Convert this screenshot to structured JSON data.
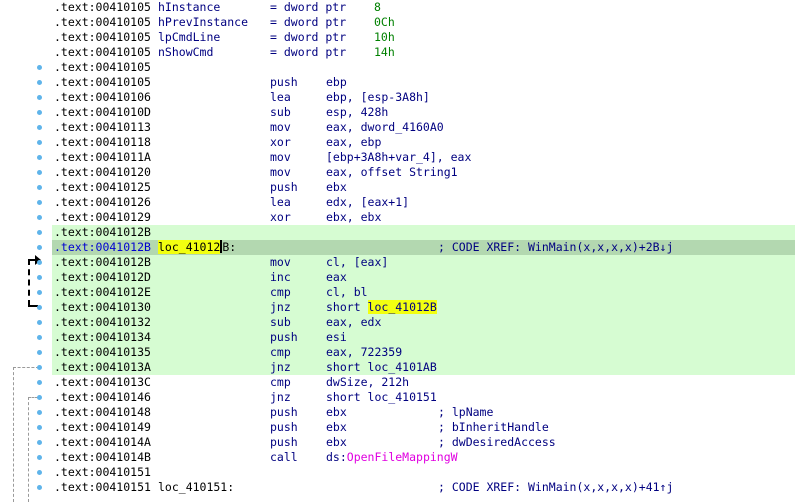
{
  "colors": {
    "code_bg": "#ffffff",
    "block_bg": "#d6fcd2",
    "current_line_bg": "#b3d8b0",
    "highlight": "#f2ff10",
    "breakpoint_dot": "#5fb4ea",
    "text_blue": "#000080",
    "constant_green": "#008000",
    "import_pink": "#e000e0"
  },
  "lines": [
    {
      "addr": ".text:00410105",
      "name": "hInstance",
      "eq": "= dword ptr",
      "val": "8"
    },
    {
      "addr": ".text:00410105",
      "name": "hPrevInstance",
      "eq": "= dword ptr",
      "val": "0Ch"
    },
    {
      "addr": ".text:00410105",
      "name": "lpCmdLine",
      "eq": "= dword ptr",
      "val": "10h"
    },
    {
      "addr": ".text:00410105",
      "name": "nShowCmd",
      "eq": "= dword ptr",
      "val": "14h"
    },
    {
      "addr": ".text:00410105"
    },
    {
      "addr": ".text:00410105",
      "mn": "push",
      "op": "ebp"
    },
    {
      "addr": ".text:00410106",
      "mn": "lea",
      "op": "ebp, [esp-3A8h]"
    },
    {
      "addr": ".text:0041010D",
      "mn": "sub",
      "op": "esp, 428h"
    },
    {
      "addr": ".text:00410113",
      "mn": "mov",
      "op": "eax, dword_4160A0"
    },
    {
      "addr": ".text:00410118",
      "mn": "xor",
      "op": "eax, ebp"
    },
    {
      "addr": ".text:0041011A",
      "mn": "mov",
      "op": "[ebp+3A8h+var_4], eax"
    },
    {
      "addr": ".text:00410120",
      "mn": "mov",
      "op": "eax, offset String1"
    },
    {
      "addr": ".text:00410125",
      "mn": "push",
      "op": "ebx"
    },
    {
      "addr": ".text:00410126",
      "mn": "lea",
      "op": "edx, [eax+1]"
    },
    {
      "addr": ".text:00410129",
      "mn": "xor",
      "op": "ebx, ebx"
    },
    {
      "addr": ".text:0041012B"
    },
    {
      "addr": ".text:0041012B",
      "label_a": "loc_41012",
      "label_b": "B:",
      "xref": "; CODE XREF: WinMain(x,x,x,x)+2B↓j"
    },
    {
      "addr": ".text:0041012B",
      "mn": "mov",
      "op": "cl, [eax]"
    },
    {
      "addr": ".text:0041012D",
      "mn": "inc",
      "op": "eax"
    },
    {
      "addr": ".text:0041012E",
      "mn": "cmp",
      "op": "cl, bl"
    },
    {
      "addr": ".text:00410130",
      "mn": "jnz",
      "op_pre": "short ",
      "op_hl": "loc_41012B"
    },
    {
      "addr": ".text:00410132",
      "mn": "sub",
      "op": "eax, edx"
    },
    {
      "addr": ".text:00410134",
      "mn": "push",
      "op": "esi"
    },
    {
      "addr": ".text:00410135",
      "mn": "cmp",
      "op": "eax, 722359"
    },
    {
      "addr": ".text:0041013A",
      "mn": "jnz",
      "op": "short loc_4101AB"
    },
    {
      "addr": ".text:0041013C",
      "mn": "cmp",
      "op": "dwSize, 212h"
    },
    {
      "addr": ".text:00410146",
      "mn": "jnz",
      "op": "short loc_410151"
    },
    {
      "addr": ".text:00410148",
      "mn": "push",
      "op": "ebx",
      "cm": "; lpName"
    },
    {
      "addr": ".text:00410149",
      "mn": "push",
      "op": "ebx",
      "cm": "; bInheritHandle"
    },
    {
      "addr": ".text:0041014A",
      "mn": "push",
      "op": "ebx",
      "cm": "; dwDesiredAccess"
    },
    {
      "addr": ".text:0041014B",
      "mn": "call",
      "op_pre": "ds:",
      "op_imp": "OpenFileMappingW"
    },
    {
      "addr": ".text:00410151"
    },
    {
      "addr": ".text:00410151",
      "label": "loc_410151:",
      "xref": "; CODE XREF: WinMain(x,x,x,x)+41↑j"
    }
  ]
}
